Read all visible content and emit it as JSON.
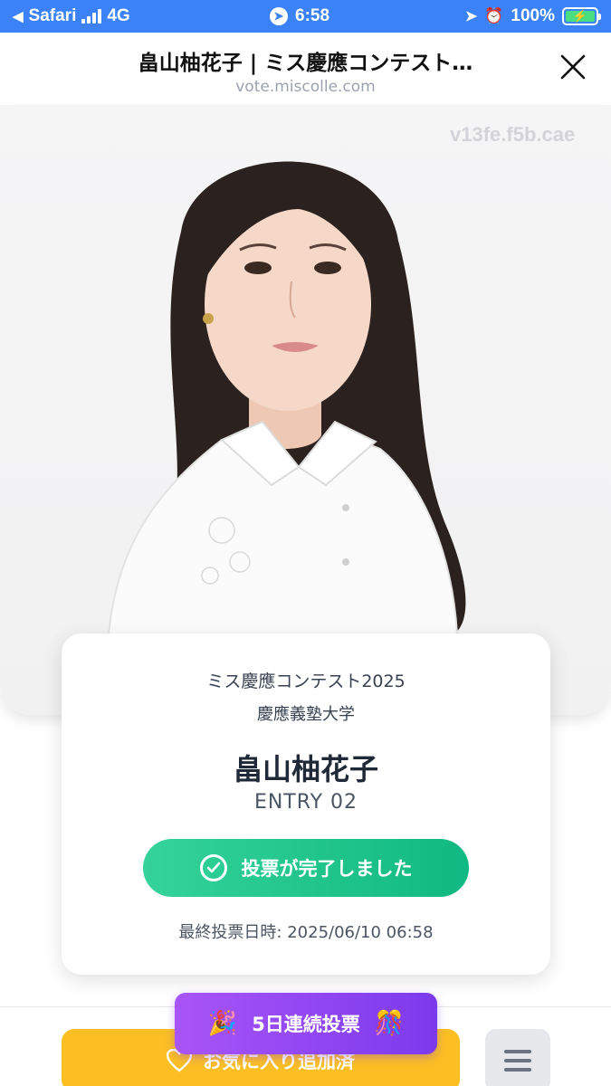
{
  "status_bar": {
    "back_app": "Safari",
    "network": "4G",
    "time": "6:58",
    "battery": "100%"
  },
  "browser": {
    "page_title": "畠山柚花子 | ミス慶應コンテスト…",
    "url": "vote.miscolle.com"
  },
  "photo": {
    "watermark": "v13fe.f5b.cae"
  },
  "card": {
    "contest": "ミス慶應コンテスト2025",
    "university": "慶應義塾大学",
    "name": "畠山柚花子",
    "entry": "ENTRY 02",
    "vote_status": "投票が完了しました",
    "last_vote": "最終投票日時: 2025/06/10 06:58"
  },
  "bottom": {
    "favorite_label": "お気に入り追加済",
    "streak_label": "5日連続投票"
  },
  "colors": {
    "status_bar": "#3b82f6",
    "vote_green": "#10b981",
    "favorite_orange": "#fbbf24",
    "streak_purple": "#7c3aed"
  }
}
